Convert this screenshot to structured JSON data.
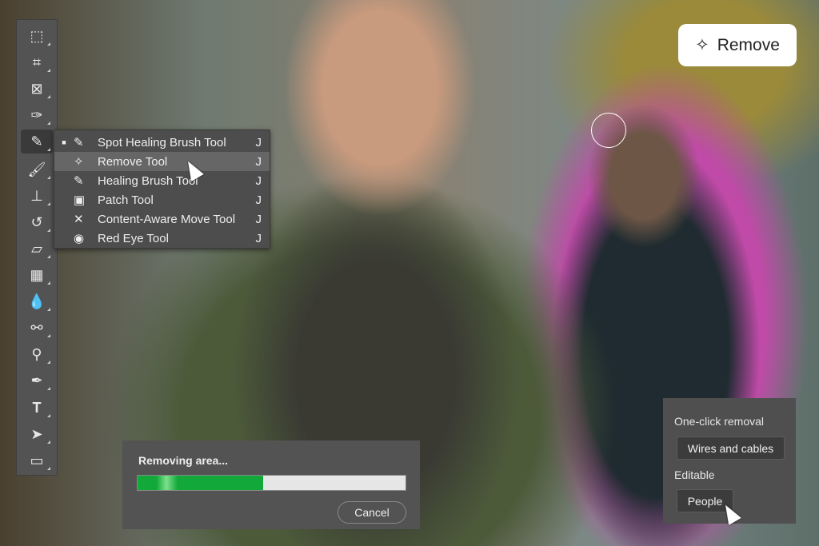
{
  "toolbar": {
    "tools": [
      "move-select",
      "crop",
      "frame",
      "eyedropper",
      "spot-healing",
      "brush",
      "clone-stamp",
      "history-brush",
      "eraser",
      "gradient",
      "blur",
      "dodge",
      "burn",
      "pen",
      "type",
      "path-select",
      "rectangle"
    ]
  },
  "flyout": {
    "items": [
      {
        "label": "Spot Healing Brush Tool",
        "key": "J",
        "icon": "✎",
        "selected": true
      },
      {
        "label": "Remove Tool",
        "key": "J",
        "icon": "✧",
        "highlighted": true
      },
      {
        "label": "Healing Brush Tool",
        "key": "J",
        "icon": "✎"
      },
      {
        "label": "Patch Tool",
        "key": "J",
        "icon": "▣"
      },
      {
        "label": "Content-Aware Move Tool",
        "key": "J",
        "icon": "✕"
      },
      {
        "label": "Red Eye Tool",
        "key": "J",
        "icon": "◉"
      }
    ]
  },
  "badge": {
    "label": "Remove",
    "icon": "✧"
  },
  "progress": {
    "title": "Removing area...",
    "value": 0.47,
    "cancel_label": "Cancel"
  },
  "oneclick": {
    "heading": "One-click removal",
    "wires_label": "Wires and cables",
    "editable_label": "Editable",
    "people_label": "People"
  },
  "colors": {
    "panel": "#535353",
    "progress": "#12a83a",
    "mask": "#c04aa8"
  }
}
